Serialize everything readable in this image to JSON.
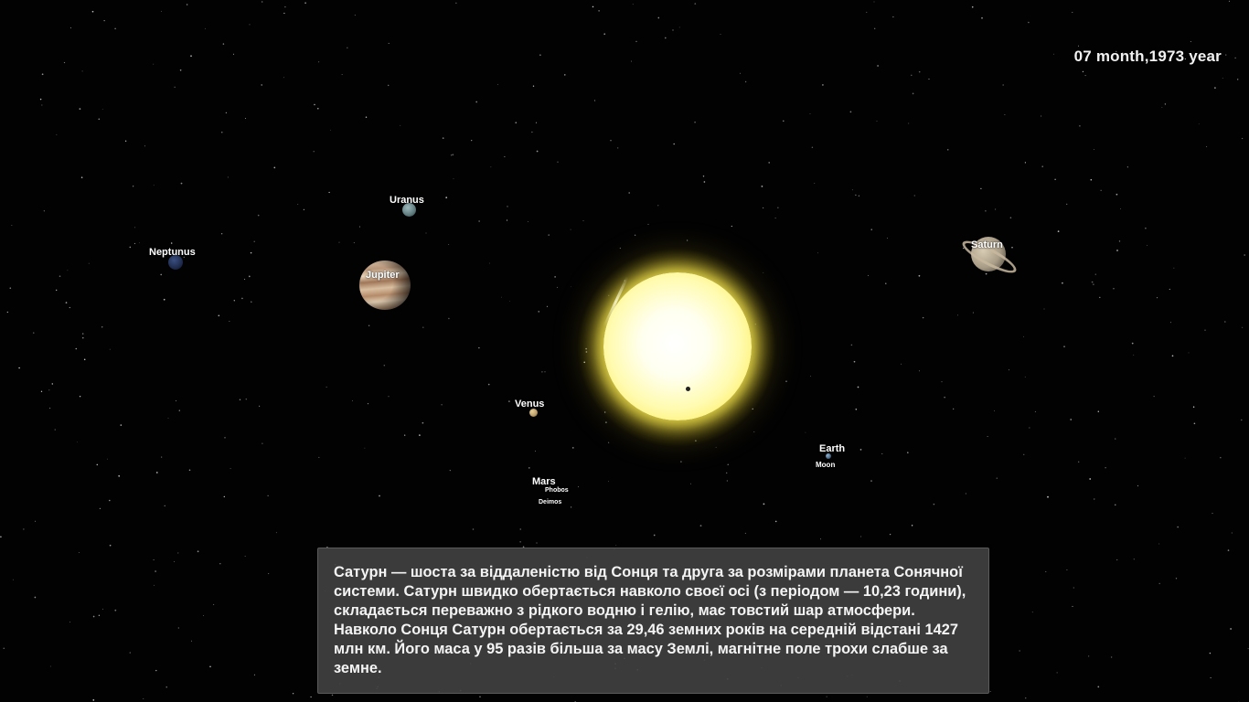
{
  "date_label": "07 month,1973 year",
  "planets": {
    "uranus": {
      "label": "Uranus",
      "color": "#5f7b7e"
    },
    "neptunus": {
      "label": "Neptunus",
      "color": "#1f2c4e"
    },
    "jupiter": {
      "label": "Jupiter",
      "color": "#b8967a"
    },
    "saturn": {
      "label": "Saturn",
      "color": "#a89c86"
    },
    "venus": {
      "label": "Venus",
      "color": "#b89a66"
    },
    "earth": {
      "label": "Earth",
      "color": "#4a6a8a"
    },
    "moon": {
      "label": "Moon"
    },
    "mars": {
      "label": "Mars"
    },
    "phobos": {
      "label": "Phobos"
    },
    "deimos": {
      "label": "Deimos"
    }
  },
  "info_box": {
    "text": "Сатурн — шоста за віддаленістю від Сонця та друга за розмірами планета Сонячної системи. Сатурн швидко обертається навколо своєї осі (з періодом — 10,23 години), складається переважно з рідкого водню і гелію, має товстий шар атмосфери. Навколо Сонця Сатурн обертається за 29,46 земних років на середній відстані 1427 млн км. Його маса у 95 разів більша за масу Землі, магнітне поле трохи слабше за земне."
  }
}
